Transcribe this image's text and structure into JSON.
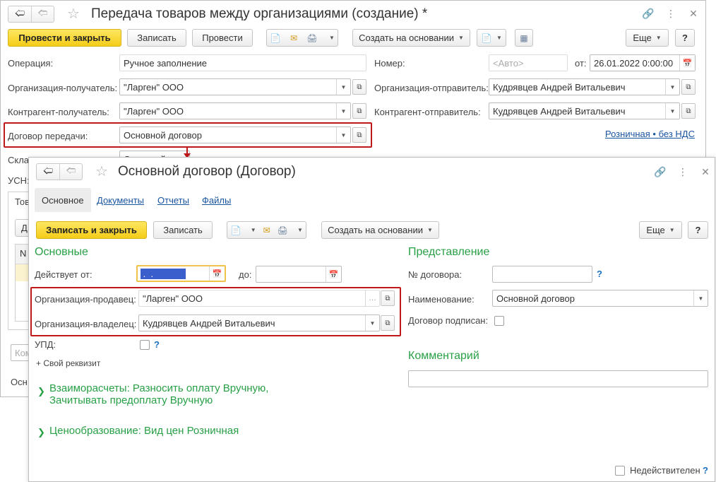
{
  "back_window": {
    "title": "Передача товаров между организациями (создание) *",
    "toolbar": {
      "post_close": "Провести и закрыть",
      "write": "Записать",
      "post": "Провести",
      "create_based": "Создать на основании",
      "more": "Еще",
      "help": "?"
    },
    "fields": {
      "operation_label": "Операция:",
      "operation_value": "Ручное заполнение",
      "number_label": "Номер:",
      "number_placeholder": "<Авто>",
      "date_label": "от:",
      "date_value": "26.01.2022  0:00:00",
      "org_recipient_label": "Организация-получатель:",
      "org_recipient_value": "\"Ларген\" ООО",
      "org_sender_label": "Организация-отправитель:",
      "org_sender_value": "Кудрявцев Андрей Витальевич",
      "contr_recipient_label": "Контрагент-получатель:",
      "contr_recipient_value": "\"Ларген\" ООО",
      "contr_sender_label": "Контрагент-отправитель:",
      "contr_sender_value": "Кудрявцев Андрей Витальевич",
      "contract_label": "Договор передачи:",
      "contract_value": "Основной договор",
      "price_link": "Розничная • без НДС",
      "warehouse_label": "Склад:",
      "warehouse_value_partial": "Основной скл",
      "usn_label": "УСН:",
      "tab_partial": "Тов",
      "btn_partial": "Д",
      "col_partial": "N",
      "comment_partial": "Ком",
      "footer_partial": "Осн"
    }
  },
  "front_window": {
    "title": "Основной договор (Договор)",
    "tabs": [
      "Основное",
      "Документы",
      "Отчеты",
      "Файлы"
    ],
    "toolbar": {
      "write_close": "Записать и закрыть",
      "write": "Записать",
      "create_based": "Создать на основании",
      "more": "Еще",
      "help": "?"
    },
    "main": {
      "section_title": "Основные",
      "valid_from_label": "Действует от:",
      "valid_from_value": " .  . ",
      "to_label": "до:",
      "to_value": " .  . ",
      "seller_label": "Организация-продавец:",
      "seller_value": "\"Ларген\" ООО",
      "owner_label": "Организация-владелец:",
      "owner_value": "Кудрявцев Андрей Витальевич",
      "upd_label": "УПД:",
      "custom_attr": "+ Свой реквизит",
      "settlements_line1": "Взаиморасчеты: Разносить оплату Вручную,",
      "settlements_line2": "Зачитывать предоплату Вручную",
      "pricing": "Ценообразование: Вид цен Розничная"
    },
    "presentation": {
      "section_title": "Представление",
      "contract_no_label": "№ договора:",
      "contract_no_value": "",
      "name_label": "Наименование:",
      "name_value": "Основной договор",
      "signed_label": "Договор подписан:",
      "help_mark": "?"
    },
    "comment": {
      "section_title": "Комментарий",
      "value": ""
    },
    "footer": {
      "invalid_label": "Недействителен",
      "help_mark": "?"
    }
  },
  "colors": {
    "accent_yellow": "#f4cc18",
    "section_green": "#28a046",
    "link_blue": "#1a55a0",
    "highlight_red": "#c01818",
    "selection_blue": "#3a5fcd"
  }
}
